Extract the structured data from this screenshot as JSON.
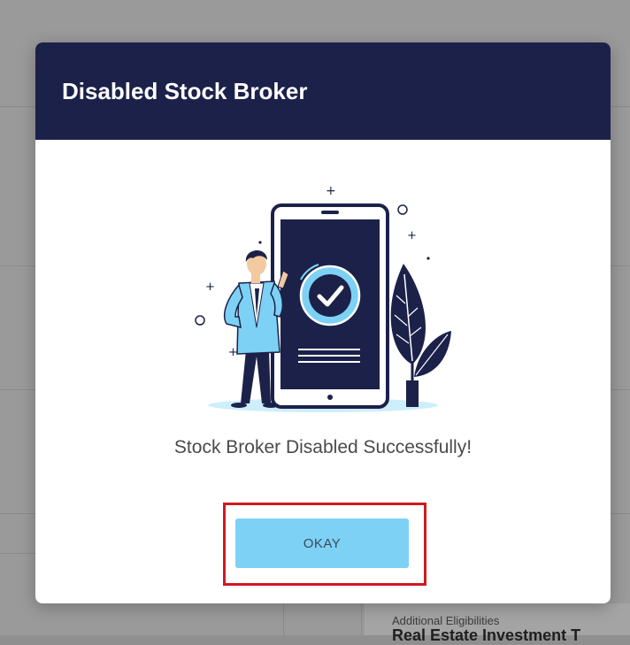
{
  "background": {
    "section_label": "Additional Eligibilities",
    "section_heading": "Real Estate Investment T"
  },
  "modal": {
    "title": "Disabled Stock Broker",
    "message": "Stock Broker Disabled Successfully!",
    "okay_label": "OKAY",
    "illustration_icon": "success-phone-check-illustration"
  },
  "colors": {
    "header_bg": "#1b2149",
    "button_bg": "#7dd1f5",
    "highlight_border": "#d0191f"
  }
}
